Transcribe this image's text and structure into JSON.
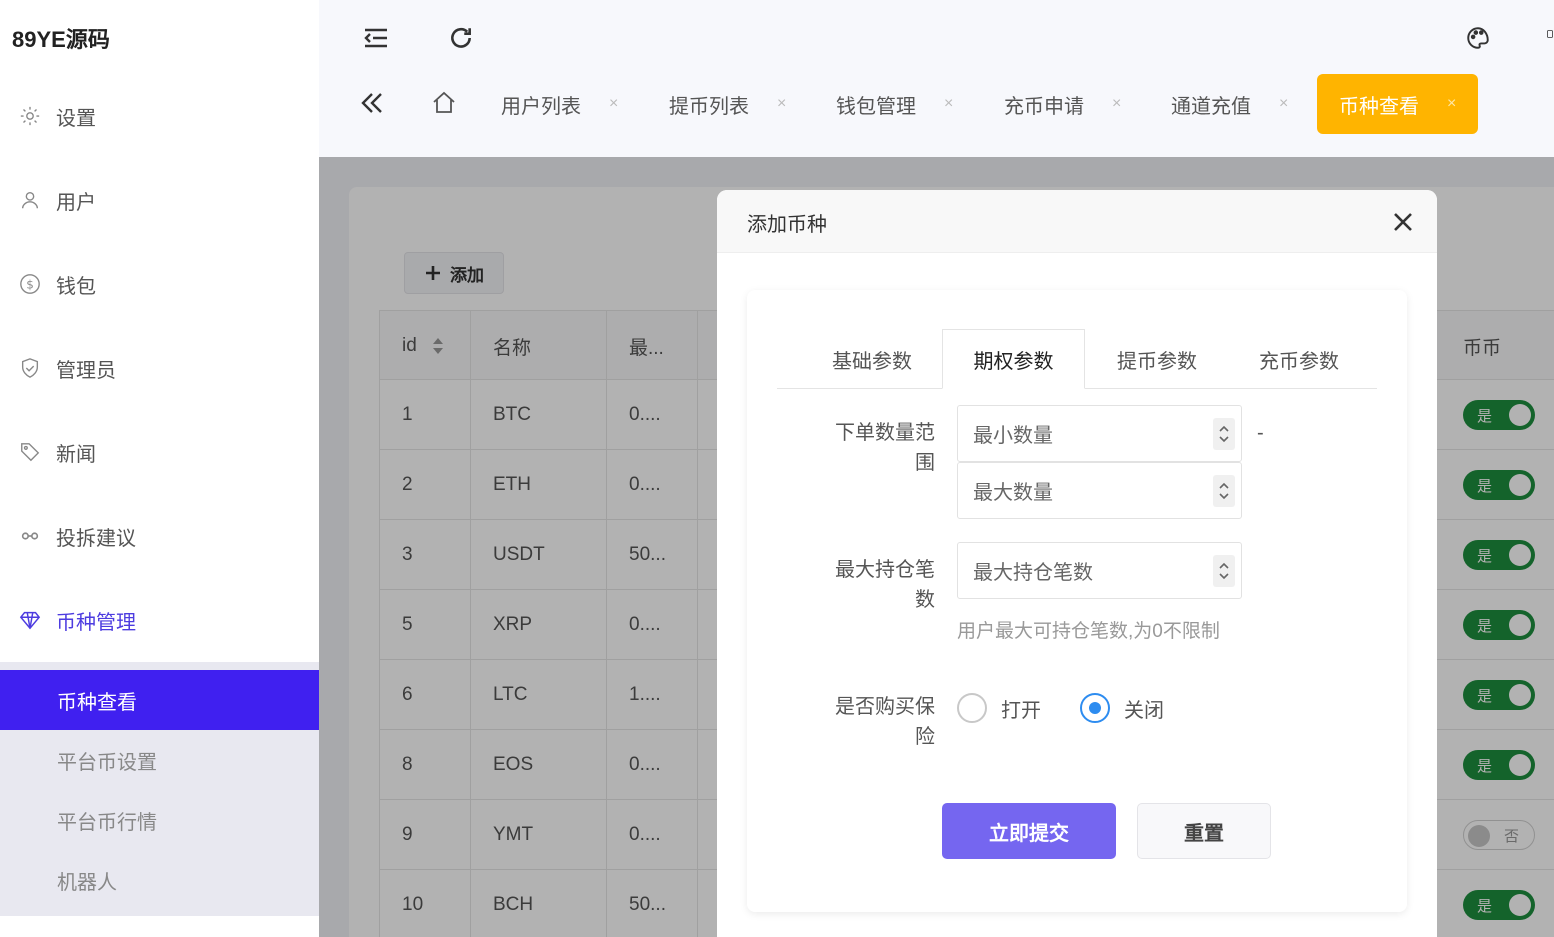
{
  "app": {
    "logo": "89YE源码"
  },
  "sidebar": {
    "items": [
      {
        "label": "设置",
        "icon": "gear-icon"
      },
      {
        "label": "用户",
        "icon": "user-icon"
      },
      {
        "label": "钱包",
        "icon": "dollar-icon"
      },
      {
        "label": "管理员",
        "icon": "shield-icon"
      },
      {
        "label": "新闻",
        "icon": "tag-icon"
      },
      {
        "label": "投拆建议",
        "icon": "link-icon"
      },
      {
        "label": "币种管理",
        "icon": "diamond-icon"
      }
    ],
    "subitems": [
      "币种查看",
      "平台币设置",
      "平台币行情",
      "机器人"
    ]
  },
  "tabs": [
    "用户列表",
    "提币列表",
    "钱包管理",
    "充币申请",
    "通道充值",
    "币种查看"
  ],
  "tab_close": "×",
  "toolbar": {
    "add_label": "添加"
  },
  "table": {
    "headers": [
      "id",
      "名称",
      "最...",
      "币币"
    ],
    "rows": [
      {
        "id": "1",
        "name": "BTC",
        "v": "0....",
        "toggle": "是",
        "on": true
      },
      {
        "id": "2",
        "name": "ETH",
        "v": "0....",
        "toggle": "是",
        "on": true
      },
      {
        "id": "3",
        "name": "USDT",
        "v": "50...",
        "toggle": "是",
        "on": true
      },
      {
        "id": "5",
        "name": "XRP",
        "v": "0....",
        "toggle": "是",
        "on": true
      },
      {
        "id": "6",
        "name": "LTC",
        "v": "1....",
        "toggle": "是",
        "on": true
      },
      {
        "id": "8",
        "name": "EOS",
        "v": "0....",
        "toggle": "是",
        "on": true
      },
      {
        "id": "9",
        "name": "YMT",
        "v": "0....",
        "toggle": "否",
        "on": false
      },
      {
        "id": "10",
        "name": "BCH",
        "v": "50...",
        "toggle": "是",
        "on": true
      }
    ]
  },
  "modal": {
    "title": "添加币种",
    "tabs": [
      "基础参数",
      "期权参数",
      "提币参数",
      "充币参数"
    ],
    "active_tab": 1,
    "fields": {
      "order_range_label_1": "下单数量范",
      "order_range_label_2": "围",
      "min_placeholder": "最小数量",
      "range_sep": "-",
      "max_placeholder": "最大数量",
      "max_pos_label_1": "最大持仓笔",
      "max_pos_label_2": "数",
      "max_pos_placeholder": "最大持仓笔数",
      "max_pos_hint": "用户最大可持仓笔数,为0不限制",
      "insurance_label_1": "是否购买保",
      "insurance_label_2": "险",
      "insurance_on": "打开",
      "insurance_off": "关闭",
      "insurance_selected": "关闭"
    },
    "submit_label": "立即提交",
    "reset_label": "重置"
  },
  "colors": {
    "accent": "#4020f0",
    "tab_active": "#ffb400",
    "toggle_on": "#1e8e3e",
    "submit": "#7566f0"
  }
}
